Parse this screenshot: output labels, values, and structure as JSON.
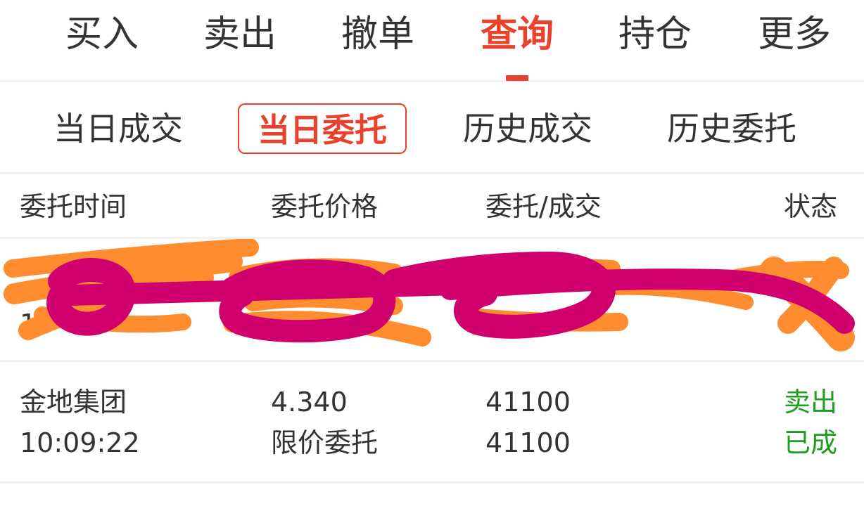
{
  "top_tabs": [
    {
      "label": "买入"
    },
    {
      "label": "卖出"
    },
    {
      "label": "撤单"
    },
    {
      "label": "查询",
      "active": true
    },
    {
      "label": "持仓"
    },
    {
      "label": "更多"
    }
  ],
  "sub_tabs": [
    {
      "label": "当日成交"
    },
    {
      "label": "当日委托",
      "active": true
    },
    {
      "label": "历史成交"
    },
    {
      "label": "历史委托"
    }
  ],
  "table": {
    "headers": [
      "委托时间",
      "委托价格",
      "委托/成交",
      "状态"
    ],
    "redacted_row": {
      "visible_time_fragment": "10"
    },
    "rows": [
      {
        "name": "金地集团",
        "time": "10:09:22",
        "price": "4.340",
        "order_type": "限价委托",
        "order_qty": "41100",
        "filled_qty": "41100",
        "direction": "卖出",
        "status": "已成"
      }
    ]
  },
  "colors": {
    "accent": "#e8412c",
    "status_green": "#1e9e1e",
    "redaction_orange": "#ff8c2e",
    "redaction_magenta": "#d0006f"
  }
}
